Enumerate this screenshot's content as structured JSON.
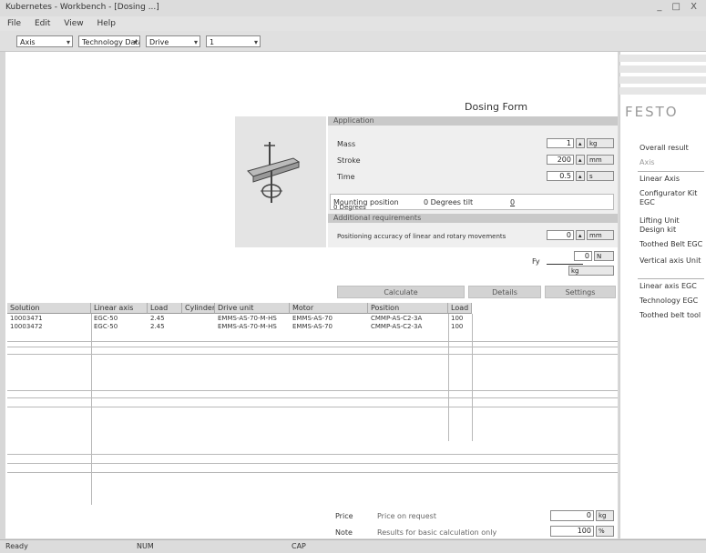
{
  "window": {
    "title": "Kubernetes - Workbench - [Dosing ...]",
    "controls": "_ □ X"
  },
  "menu": [
    "File",
    "Edit",
    "View",
    "Help"
  ],
  "toolbar": {
    "combos": [
      {
        "value": "Axis"
      },
      {
        "value": "Technology Data"
      },
      {
        "value": "Drive"
      },
      {
        "value": "1"
      }
    ]
  },
  "document": {
    "title": "Dosing Form"
  },
  "brand": {
    "logo": "FESTO"
  },
  "sidebar": {
    "items": [
      {
        "label": "Overall result"
      },
      {
        "label": "Axis"
      },
      {
        "label": "Linear Axis"
      },
      {
        "label": "Configurator Kit EGC"
      },
      {
        "label": "Lifting Unit Design kit"
      },
      {
        "label": "Toothed Belt EGC"
      },
      {
        "label": "Vertical axis Unit"
      },
      {
        "label": "Linear axis EGC"
      },
      {
        "label": "Technology EGC"
      },
      {
        "label": "Toothed belt tool"
      }
    ]
  },
  "application": {
    "header": "Application",
    "rows": [
      {
        "label": "Mass",
        "value": "1",
        "unit": "kg"
      },
      {
        "label": "Stroke",
        "value": "200",
        "unit": "mm"
      },
      {
        "label": "Time",
        "value": "0.5",
        "unit": "s"
      }
    ],
    "mounting": {
      "label": "Mounting position",
      "left": "0 Degrees",
      "mid": "0 Degrees tilt",
      "right": "0"
    },
    "additional": {
      "header": "Additional requirements",
      "row": {
        "label": "Positioning accuracy of linear and rotary movements",
        "value": "0",
        "unit": "mm"
      }
    },
    "load": {
      "label": "Fy",
      "value": "0",
      "unit": "N",
      "sub_unit": "kg"
    }
  },
  "actions": {
    "calculate": "Calculate",
    "details": "Details",
    "settings": "Settings"
  },
  "table": {
    "columns": [
      "Solution",
      "Linear axis",
      "Load",
      "Cylinder",
      "Drive unit",
      "Motor",
      "Position",
      "Load %"
    ],
    "rows": [
      [
        "10003471",
        "EGC-50",
        "2.45",
        "",
        "EMMS-AS-70-M-HS",
        "EMMS-AS-70",
        "CMMP-AS-C2-3A",
        "100"
      ],
      [
        "10003472",
        "EGC-50",
        "2.45",
        "",
        "EMMS-AS-70-M-HS",
        "EMMS-AS-70",
        "CMMP-AS-C2-3A",
        "100"
      ]
    ]
  },
  "footer": {
    "price_label": "Price",
    "price_value": "Price on request",
    "note_label": "Note",
    "note_value": "Results for basic calculation only",
    "qty": "0",
    "qty_unit": "kg",
    "total": "100",
    "total_unit": "%"
  },
  "status": {
    "left": "Ready",
    "mid": "NUM",
    "right": "CAP"
  }
}
